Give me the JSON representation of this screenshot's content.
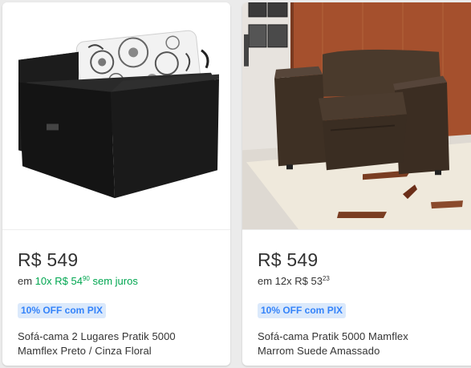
{
  "products": [
    {
      "price": "R$ 549",
      "installment_prefix": "em ",
      "installment_count": "10x",
      "installment_currency": " R$ 54",
      "installment_cents": "90",
      "installment_suffix": " sem juros",
      "badge": "10% OFF com PIX",
      "title_line1": "Sofá-cama 2 Lugares Pratik 5000",
      "title_line2": "Mamflex Preto / Cinza Floral",
      "image_alt": "black sofa bed with floral cushion"
    },
    {
      "price": "R$ 549",
      "installment_prefix": "em ",
      "installment_count": "12x",
      "installment_currency": " R$ 53",
      "installment_cents": "23",
      "badge": "10% OFF com PIX",
      "title_line1": "Sofá-cama Pratik 5000 Mamflex",
      "title_line2": "Marrom Suede Amassado",
      "image_alt": "brown suede sofa bed on patterned rug"
    }
  ],
  "colors": {
    "green": "#00a650",
    "badge_bg": "#dbe9fb",
    "badge_text": "#3483fa",
    "background": "#ebebeb"
  }
}
